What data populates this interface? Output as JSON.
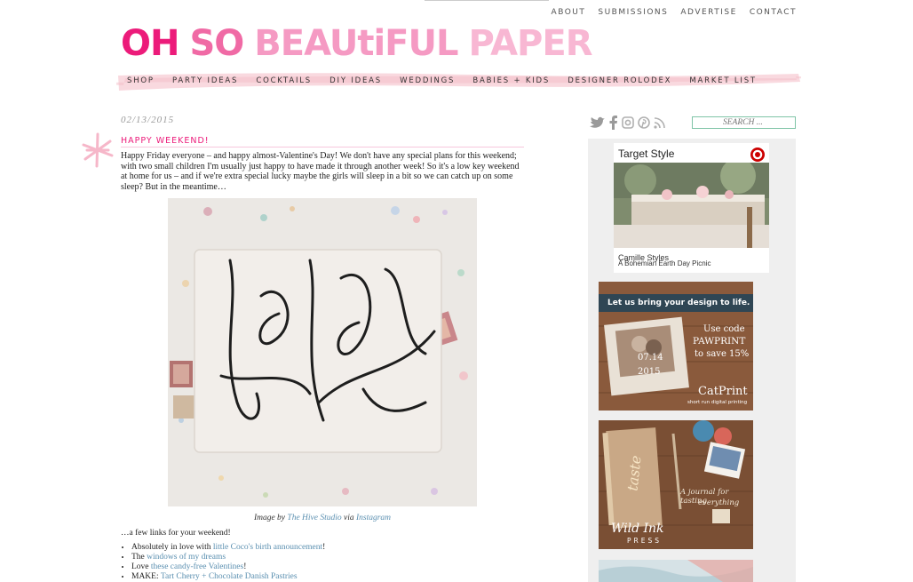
{
  "top_nav": [
    "ABOUT",
    "SUBMISSIONS",
    "ADVERTISE",
    "CONTACT"
  ],
  "logo": {
    "w1": "OH",
    "w2": "SO",
    "w3": "BEAUtiFUL",
    "w4": "PAPER"
  },
  "main_nav": [
    "SHOP",
    "PARTY IDEAS",
    "COCKTAILS",
    "DIY IDEAS",
    "WEDDINGS",
    "BABIES + KIDS",
    "DESIGNER ROLODEX",
    "MARKET LIST"
  ],
  "post": {
    "date": "02/13/2015",
    "title": "HAPPY WEEKEND!",
    "body": "Happy Friday everyone – and happy almost-Valentine's Day! We don't have any special plans for this weekend; with two small children I'm usually just happy to have made it through another week! So it's a low key weekend at home for us – and if we're extra special lucky maybe the girls will sleep in a bit so we can catch up on some sleep? But in the meantime…",
    "caption": {
      "prefix": "Image by ",
      "author": "The Hive Studio",
      "via": " via ",
      "source": "Instagram"
    },
    "links_intro": "…a few links for your weekend!",
    "links": [
      {
        "before": "Absolutely in love with ",
        "link": "little Coco's birth announcement",
        "after": "!"
      },
      {
        "before": "The ",
        "link": "windows of my dreams",
        "after": ""
      },
      {
        "before": "Love ",
        "link": "these candy-free Valentines",
        "after": "!"
      },
      {
        "before": "MAKE: ",
        "link": "Tart Cherry + Chocolate Danish Pastries",
        "after": ""
      }
    ]
  },
  "sidebar": {
    "social_icons": [
      "twitter-icon",
      "facebook-icon",
      "instagram-icon",
      "pinterest-icon",
      "rss-icon"
    ],
    "search_placeholder": "SEARCH ...",
    "target": {
      "title": "Target Style",
      "source": "Camille Styles",
      "headline": "A Bohemian Earth Day Picnic"
    },
    "ad1": {
      "headline": "Let us bring your design to life.",
      "line1": "Use code",
      "code": "PAWPRINT",
      "line2": "to save 15%",
      "brand": "CatPrint",
      "tagline": "short run digital printing",
      "card_date": "07.14",
      "card_year": "2015"
    },
    "ad2": {
      "script": "taste",
      "line1": "A journal for tasting",
      "line2": "everything",
      "brand": "Wild Ink",
      "brand_sub": "PRESS"
    }
  },
  "colors": {
    "brand_pink": "#ec1b7a",
    "link_blue": "#5a8fb0",
    "nav_stroke": "#f6cbd4",
    "search_border": "#7fc4a7"
  }
}
